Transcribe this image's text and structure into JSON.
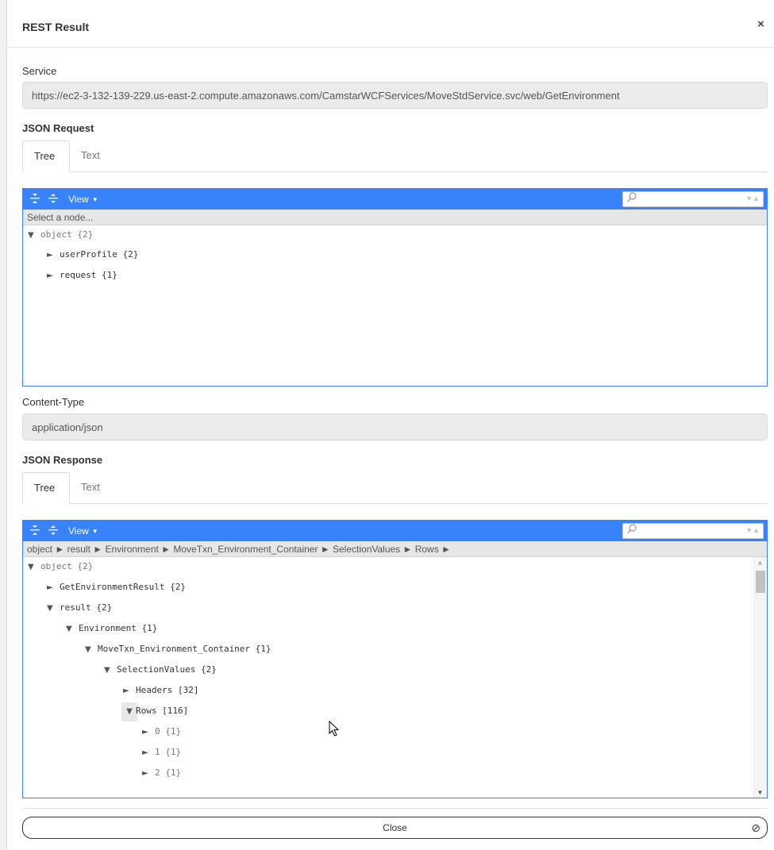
{
  "dialog": {
    "title": "REST Result",
    "close_glyph": "×"
  },
  "service": {
    "label": "Service",
    "value": "https://ec2-3-132-139-229.us-east-2.compute.amazonaws.com/CamstarWCFServices/MoveStdService.svc/web/GetEnvironment"
  },
  "request": {
    "label": "JSON Request",
    "tabs": [
      "Tree",
      "Text"
    ],
    "editor": {
      "view_label": "View",
      "navbar": "Select a node...",
      "rows": [
        {
          "toggle": "▼",
          "key": "object {2}",
          "muted": true
        },
        {
          "toggle": "►",
          "key": "userProfile {2}"
        },
        {
          "toggle": "►",
          "key": "request {1}"
        }
      ]
    }
  },
  "content_type": {
    "label": "Content-Type",
    "value": "application/json"
  },
  "response": {
    "label": "JSON Response",
    "tabs": [
      "Tree",
      "Text"
    ],
    "editor": {
      "view_label": "View",
      "navbar": "object ► result ► Environment ► MoveTxn_Environment_Container ► SelectionValues ► Rows ►",
      "rows": [
        {
          "toggle": "▼",
          "key": "object {2}",
          "muted": true
        },
        {
          "toggle": "►",
          "key": "GetEnvironmentResult {2}"
        },
        {
          "toggle": "▼",
          "key": "result {2}"
        },
        {
          "toggle": "▼",
          "key": "Environment {1}"
        },
        {
          "toggle": "▼",
          "key": "MoveTxn_Environment_Container {1}"
        },
        {
          "toggle": "▼",
          "key": "SelectionValues {2}"
        },
        {
          "toggle": "►",
          "key": "Headers [32]"
        },
        {
          "toggle": "▼",
          "key": "Rows [116]",
          "highlight": true
        },
        {
          "toggle": "►",
          "key": "0 {1}"
        },
        {
          "toggle": "►",
          "key": "1 {1}"
        },
        {
          "toggle": "►",
          "key": "2 {1}"
        }
      ]
    }
  },
  "footer": {
    "close_label": "Close",
    "close_glyph": "⊘"
  },
  "icons": {
    "collapse_all": "collapse-all-icon",
    "expand_all": "expand-all-icon",
    "search": "search-icon",
    "dialog_close": "close-icon",
    "cancel": "cancel-icon"
  },
  "colors": {
    "editor_accent": "#3883fa"
  }
}
